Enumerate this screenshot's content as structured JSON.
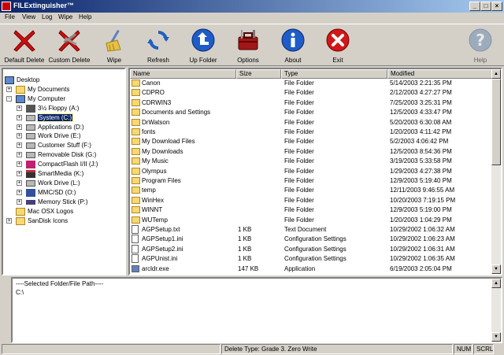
{
  "window": {
    "title": "FILExtinguisher™"
  },
  "menu": [
    "File",
    "View",
    "Log",
    "Wipe",
    "Help"
  ],
  "toolbar": [
    {
      "label": "Default Delete",
      "icon": "red-x-icon"
    },
    {
      "label": "Custom Delete",
      "icon": "red-x-tools-icon"
    },
    {
      "label": "Wipe",
      "icon": "broom-icon"
    },
    {
      "label": "Refresh",
      "icon": "refresh-icon"
    },
    {
      "label": "Up Folder",
      "icon": "up-folder-icon"
    },
    {
      "label": "Options",
      "icon": "toolbox-icon"
    },
    {
      "label": "About",
      "icon": "info-icon"
    },
    {
      "label": "Exit",
      "icon": "exit-icon"
    },
    {
      "label": "Help",
      "icon": "help-icon"
    }
  ],
  "tree": [
    {
      "label": "Desktop",
      "level": 0,
      "expander": "",
      "icon": "desktop-icon"
    },
    {
      "label": "My Documents",
      "level": 1,
      "expander": "+",
      "icon": "folder-icon"
    },
    {
      "label": "My Computer",
      "level": 1,
      "expander": "-",
      "icon": "computer-icon"
    },
    {
      "label": "3½ Floppy (A:)",
      "level": 2,
      "expander": "+",
      "icon": "floppy-icon"
    },
    {
      "label": "System (C:)",
      "level": 2,
      "expander": "+",
      "icon": "drive-icon",
      "selected": true
    },
    {
      "label": "Applications (D:)",
      "level": 2,
      "expander": "+",
      "icon": "drive-icon"
    },
    {
      "label": "Work Drive (E:)",
      "level": 2,
      "expander": "+",
      "icon": "drive-icon"
    },
    {
      "label": "Customer Stuff (F:)",
      "level": 2,
      "expander": "+",
      "icon": "drive-icon"
    },
    {
      "label": "Removable Disk (G:)",
      "level": 2,
      "expander": "+",
      "icon": "removable-icon"
    },
    {
      "label": "CompactFlash I/II (J:)",
      "level": 2,
      "expander": "+",
      "icon": "compactflash-icon"
    },
    {
      "label": "SmartMedia (K:)",
      "level": 2,
      "expander": "+",
      "icon": "smartmedia-icon"
    },
    {
      "label": "Work Drive (L:)",
      "level": 2,
      "expander": "+",
      "icon": "drive-icon"
    },
    {
      "label": "MMC/SD (O:)",
      "level": 2,
      "expander": "+",
      "icon": "mmc-icon"
    },
    {
      "label": "Memory Stick (P:)",
      "level": 2,
      "expander": "+",
      "icon": "memorystick-icon"
    },
    {
      "label": "Mac OSX Logos",
      "level": 1,
      "expander": "",
      "icon": "folder-icon"
    },
    {
      "label": "SanDisk Icons",
      "level": 1,
      "expander": "+",
      "icon": "folder-icon"
    }
  ],
  "columns": [
    "Name",
    "Size",
    "Type",
    "Modified"
  ],
  "files": [
    {
      "name": "Canon",
      "size": "",
      "type": "File Folder",
      "modified": "5/14/2003 2:21:35 PM",
      "kind": "folder"
    },
    {
      "name": "CDPRO",
      "size": "",
      "type": "File Folder",
      "modified": "2/12/2003 4:27:27 PM",
      "kind": "folder"
    },
    {
      "name": "CDRWIN3",
      "size": "",
      "type": "File Folder",
      "modified": "7/25/2003 3:25:31 PM",
      "kind": "folder"
    },
    {
      "name": "Documents and Settings",
      "size": "",
      "type": "File Folder",
      "modified": "12/5/2003 4:33:47 PM",
      "kind": "folder"
    },
    {
      "name": "DrWatson",
      "size": "",
      "type": "File Folder",
      "modified": "5/20/2003 6:30:08 AM",
      "kind": "folder"
    },
    {
      "name": "fonts",
      "size": "",
      "type": "File Folder",
      "modified": "1/20/2003 4:11:42 PM",
      "kind": "folder"
    },
    {
      "name": "My Download Files",
      "size": "",
      "type": "File Folder",
      "modified": "5/2/2003 4:06:42 PM",
      "kind": "folder"
    },
    {
      "name": "My Downloads",
      "size": "",
      "type": "File Folder",
      "modified": "12/5/2003 8:54:36 PM",
      "kind": "folder"
    },
    {
      "name": "My Music",
      "size": "",
      "type": "File Folder",
      "modified": "3/19/2003 5:33:58 PM",
      "kind": "folder"
    },
    {
      "name": "Olympus",
      "size": "",
      "type": "File Folder",
      "modified": "1/29/2003 4:27:38 PM",
      "kind": "folder"
    },
    {
      "name": "Program Files",
      "size": "",
      "type": "File Folder",
      "modified": "12/9/2003 5:19:40 PM",
      "kind": "folder"
    },
    {
      "name": "temp",
      "size": "",
      "type": "File Folder",
      "modified": "12/11/2003 9:46:55 AM",
      "kind": "folder"
    },
    {
      "name": "WinHex",
      "size": "",
      "type": "File Folder",
      "modified": "10/20/2003 7:19:15 PM",
      "kind": "folder"
    },
    {
      "name": "WINNT",
      "size": "",
      "type": "File Folder",
      "modified": "12/9/2003 5:19:00 PM",
      "kind": "folder"
    },
    {
      "name": "WUTemp",
      "size": "",
      "type": "File Folder",
      "modified": "1/20/2003 1:04:29 PM",
      "kind": "folder"
    },
    {
      "name": "AGPSetup.txt",
      "size": "1 KB",
      "type": "Text Document",
      "modified": "10/29/2002 1:06:32 AM",
      "kind": "doc"
    },
    {
      "name": "AGPSetup1.ini",
      "size": "1 KB",
      "type": "Configuration Settings",
      "modified": "10/29/2002 1:06:23 AM",
      "kind": "doc"
    },
    {
      "name": "AGPSetup2.ini",
      "size": "1 KB",
      "type": "Configuration Settings",
      "modified": "10/29/2002 1:06:31 AM",
      "kind": "doc"
    },
    {
      "name": "AGPUnist.ini",
      "size": "1 KB",
      "type": "Configuration Settings",
      "modified": "10/29/2002 1:06:35 AM",
      "kind": "doc"
    },
    {
      "name": "arcldr.exe",
      "size": "147 KB",
      "type": "Application",
      "modified": "6/19/2003 2:05:04 PM",
      "kind": "exe"
    }
  ],
  "path_panel": {
    "heading": "----Selected Folder/File Path----",
    "value": "C:\\"
  },
  "status": {
    "delete_type": "Delete Type: Grade 3. Zero Write",
    "num": "NUM",
    "scrl": "SCRL"
  },
  "colors": {
    "title_start": "#0a246a",
    "title_end": "#a6caf0",
    "selection": "#0a246a",
    "folder": "#f8d775",
    "face": "#d4d0c8"
  }
}
